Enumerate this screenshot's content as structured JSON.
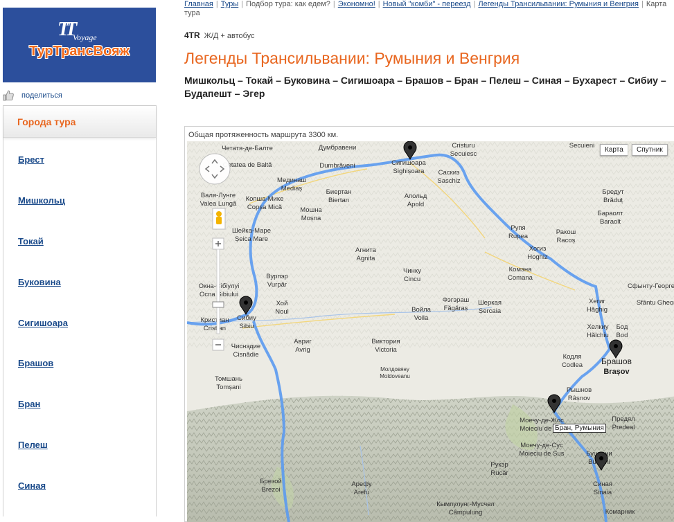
{
  "logo": {
    "sub": "Voyage",
    "name": "ТурТрансВояж"
  },
  "share": {
    "label": "поделиться"
  },
  "cities": {
    "heading": "Города тура",
    "items": [
      "Брест",
      "Мишкольц",
      "Токай",
      "Буковина",
      "Сигишоара",
      "Брашов",
      "Бран",
      "Пелеш",
      "Синая"
    ]
  },
  "breadcrumb": {
    "items": [
      "Главная",
      "Туры",
      "Подбор тура: как едем?",
      "Экономно!",
      "Новый \"комби\" - переезд",
      "Легенды Трансильвании: Румыния и Венгрия",
      "Карта тура"
    ]
  },
  "tour": {
    "code": "4TR",
    "transport": "Ж/Д + автобус",
    "title": "Легенды Трансильвании: Румыния и Венгрия",
    "route": "Мишкольц – Токай – Буковина – Сигишоара – Брашов – Бран – Пелеш – Синая – Бухарест – Сибиу – Будапешт – Эгер"
  },
  "map": {
    "total": "Общая протяженность маршрута 3300 км.",
    "type_map": "Карта",
    "type_satellite": "Спутник",
    "tooltip": "Бран, Румыния",
    "route_color": "#5b9af0",
    "labels": [
      {
        "ru": "Четатя-де-Балте",
        "lat": "Cetatea de Baltă"
      },
      {
        "ru": "Думбравени",
        "lat": "Dumbrăveni"
      },
      {
        "ru": "Сигишоара",
        "lat": "Sighișoara"
      },
      {
        "ru": "Саскиз",
        "lat": "Saschiz"
      },
      {
        "ru": "Cristuru",
        "lat": "Secuiesc"
      },
      {
        "ru": "Secuieni",
        "lat": ""
      },
      {
        "ru": "Бредут",
        "lat": "Brăduț"
      },
      {
        "ru": "Мединаш",
        "lat": "Mediaș"
      },
      {
        "ru": "Биертан",
        "lat": "Biertan"
      },
      {
        "ru": "Апольд",
        "lat": "Apold"
      },
      {
        "ru": "Копша-Мике",
        "lat": "Copșa Mică"
      },
      {
        "ru": "Валя-Лунге",
        "lat": "Valea Lungă"
      },
      {
        "ru": "Мошна",
        "lat": "Moșna"
      },
      {
        "ru": "Бараолт",
        "lat": "Baraolt"
      },
      {
        "ru": "Шейка-Маре",
        "lat": "Șeica Mare"
      },
      {
        "ru": "Рупя",
        "lat": "Rupea"
      },
      {
        "ru": "Ракош",
        "lat": "Racoș"
      },
      {
        "ru": "Хогиз",
        "lat": "Hoghiz"
      },
      {
        "ru": "Агнита",
        "lat": "Agnita"
      },
      {
        "ru": "Чинку",
        "lat": "Cincu"
      },
      {
        "ru": "Комэна",
        "lat": "Comana"
      },
      {
        "ru": "Вурпэр",
        "lat": "Vurpăr"
      },
      {
        "ru": "Окна-Сібіулуі",
        "lat": "Ocna Sibiului"
      },
      {
        "ru": "Сфынту-Георге",
        "lat": "Sfântu Gheorghe"
      },
      {
        "ru": "Фэгэраш",
        "lat": "Făgăraș"
      },
      {
        "ru": "Хой",
        "lat": "Noul"
      },
      {
        "ru": "Войла",
        "lat": "Voila"
      },
      {
        "ru": "Шеркая",
        "lat": "Șercaia"
      },
      {
        "ru": "Хегиг",
        "lat": "Hăghig"
      },
      {
        "ru": "Сибиу",
        "lat": "Sibiu"
      },
      {
        "ru": "Кристиан",
        "lat": "Cristian"
      },
      {
        "ru": "Хелкиу",
        "lat": "Hălchiu"
      },
      {
        "ru": "Бод",
        "lat": "Bod"
      },
      {
        "ru": "Чиснэдие",
        "lat": "Cisnădie"
      },
      {
        "ru": "Авриг",
        "lat": "Avrig"
      },
      {
        "ru": "Виктория",
        "lat": "Victoria"
      },
      {
        "ru": "Кодля",
        "lat": "Codlea"
      },
      {
        "ru": "Брашов",
        "lat": "Brașov"
      },
      {
        "ru": "Молдовяну",
        "lat": "Moldoveanu"
      },
      {
        "ru": "Томшань",
        "lat": "Tomșani"
      },
      {
        "ru": "Рышнов",
        "lat": "Râșnov"
      },
      {
        "ru": "Моечу-де-Жос",
        "lat": "Moieciu de Jos"
      },
      {
        "ru": "Предял",
        "lat": "Predeal"
      },
      {
        "ru": "Моечу-де-Сус",
        "lat": "Moieciu de Sus"
      },
      {
        "ru": "Бушгени",
        "lat": "Bușteni"
      },
      {
        "ru": "Рукэр",
        "lat": "Rucăr"
      },
      {
        "ru": "Брезой",
        "lat": "Brezoi"
      },
      {
        "ru": "Арефу",
        "lat": "Arefu"
      },
      {
        "ru": "Синая",
        "lat": "Sinaia"
      },
      {
        "ru": "Кымпулунг-Мусчел",
        "lat": "Câmpulung"
      },
      {
        "ru": "Комарник",
        "lat": ""
      }
    ]
  }
}
